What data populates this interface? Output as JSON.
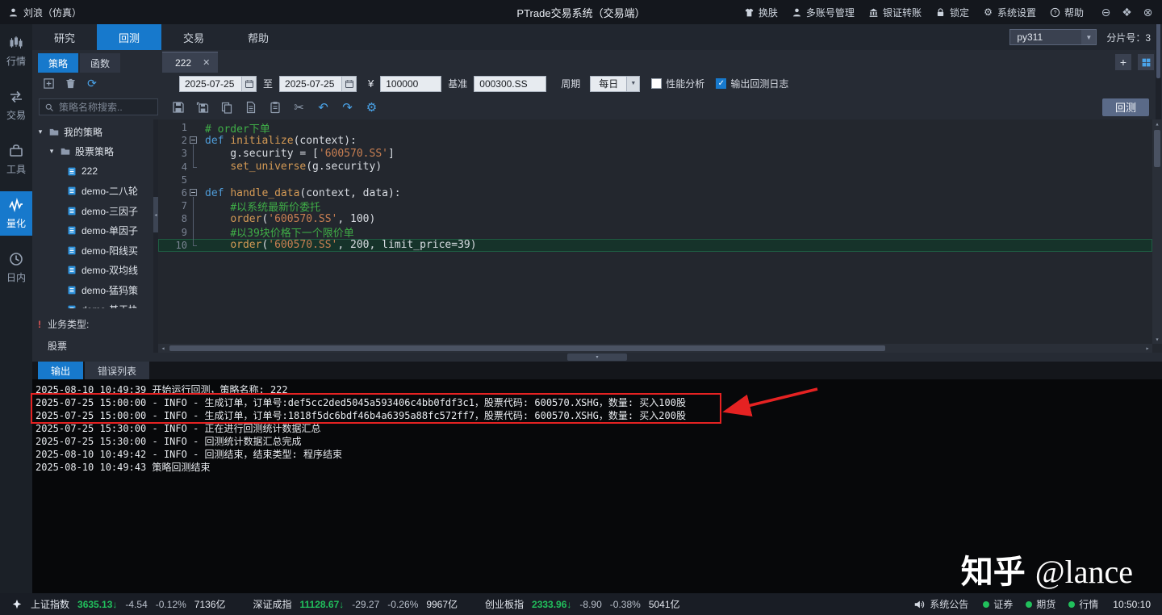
{
  "colors": {
    "accent_blue": "#1779cc",
    "down_green": "#21c05c",
    "alert_red": "#e52222"
  },
  "titlebar": {
    "user": "刘浪（仿真）",
    "title": "PTrade交易系统（交易端）",
    "actions": [
      {
        "icon": "shirt",
        "label": "换肤"
      },
      {
        "icon": "user",
        "label": "多账号管理"
      },
      {
        "icon": "bank",
        "label": "银证转账"
      },
      {
        "icon": "lock",
        "label": "锁定"
      },
      {
        "icon": "gear",
        "label": "系统设置"
      },
      {
        "icon": "help",
        "label": "帮助"
      }
    ],
    "window_buttons": [
      {
        "icon": "min",
        "name": "minimize"
      },
      {
        "icon": "max",
        "name": "maximize"
      },
      {
        "icon": "close",
        "name": "close"
      }
    ]
  },
  "navbar": {
    "tabs": [
      {
        "label": "研究",
        "active": false
      },
      {
        "label": "回测",
        "active": true
      },
      {
        "label": "交易",
        "active": false
      },
      {
        "label": "帮助",
        "active": false
      }
    ],
    "python_env": "py311",
    "shard": "分片号：3"
  },
  "rail": [
    {
      "icon": "market",
      "label": "行情",
      "active": false
    },
    {
      "icon": "trade",
      "label": "交易",
      "active": false
    },
    {
      "icon": "tools",
      "label": "工具",
      "active": false
    },
    {
      "icon": "quant",
      "label": "量化",
      "active": true
    },
    {
      "icon": "intraday",
      "label": "日内",
      "active": false
    }
  ],
  "workspace_tabs": {
    "panels": [
      {
        "label": "策略",
        "active": true
      },
      {
        "label": "函数",
        "active": false
      }
    ],
    "file_tab": "222"
  },
  "backtest_bar": {
    "strategy_toolbar": [
      "plusbox",
      "trash",
      "refresh"
    ],
    "date_from": "2025-07-25",
    "to_label": "至",
    "date_to": "2025-07-25",
    "currency": "¥",
    "capital": "100000",
    "benchmark_label": "基准",
    "benchmark": "000300.SS",
    "period_label": "周期",
    "period": "每日",
    "checkboxes": [
      {
        "label": "性能分析",
        "checked": false
      },
      {
        "label": "输出回测日志",
        "checked": true
      }
    ],
    "run_label": "回测"
  },
  "edit_toolbar": [
    {
      "icon": "floppy",
      "blue": false
    },
    {
      "icon": "floppyall",
      "blue": false
    },
    {
      "icon": "copy",
      "blue": false
    },
    {
      "icon": "doc",
      "blue": false
    },
    {
      "icon": "paste",
      "blue": false
    },
    {
      "icon": "scissors",
      "blue": false
    },
    {
      "icon": "undo",
      "blue": true
    },
    {
      "icon": "redo",
      "blue": true
    },
    {
      "icon": "gear",
      "blue": true
    }
  ],
  "search_placeholder": "策略名称搜索..",
  "tree": {
    "root": "我的策略",
    "group": "股票策略",
    "files": [
      "222",
      "demo-二八轮",
      "demo-三因子",
      "demo-单因子",
      "demo-阳线买",
      "demo-双均线",
      "demo-猛犸策",
      "demo-基于协"
    ]
  },
  "biz": {
    "label": "业务类型:",
    "value": "股票"
  },
  "editor": {
    "lines": [
      {
        "no": "1",
        "fold": "",
        "cur": false,
        "tokens": [
          {
            "c": "com",
            "t": "# order下单"
          }
        ]
      },
      {
        "no": "2",
        "fold": "open",
        "cur": false,
        "tokens": [
          {
            "c": "kw",
            "t": "def "
          },
          {
            "c": "fn",
            "t": "initialize"
          },
          {
            "c": "pl",
            "t": "(context):"
          }
        ]
      },
      {
        "no": "3",
        "fold": "mid",
        "cur": false,
        "tokens": [
          {
            "c": "pl",
            "t": "    g.security = ["
          },
          {
            "c": "str",
            "t": "'600570.SS'"
          },
          {
            "c": "pl",
            "t": "]"
          }
        ]
      },
      {
        "no": "4",
        "fold": "end",
        "cur": false,
        "tokens": [
          {
            "c": "pl",
            "t": "    "
          },
          {
            "c": "fn",
            "t": "set_universe"
          },
          {
            "c": "pl",
            "t": "(g.security)"
          }
        ]
      },
      {
        "no": "5",
        "fold": "",
        "cur": false,
        "tokens": []
      },
      {
        "no": "6",
        "fold": "open",
        "cur": false,
        "tokens": [
          {
            "c": "kw",
            "t": "def "
          },
          {
            "c": "fn",
            "t": "handle_data"
          },
          {
            "c": "pl",
            "t": "(context, data):"
          }
        ]
      },
      {
        "no": "7",
        "fold": "mid",
        "cur": false,
        "tokens": [
          {
            "c": "pl",
            "t": "    "
          },
          {
            "c": "com",
            "t": "#以系统最新价委托"
          }
        ]
      },
      {
        "no": "8",
        "fold": "mid",
        "cur": false,
        "tokens": [
          {
            "c": "pl",
            "t": "    "
          },
          {
            "c": "fn",
            "t": "order"
          },
          {
            "c": "pl",
            "t": "("
          },
          {
            "c": "str",
            "t": "'600570.SS'"
          },
          {
            "c": "pl",
            "t": ", 100)"
          }
        ]
      },
      {
        "no": "9",
        "fold": "mid",
        "cur": false,
        "tokens": [
          {
            "c": "pl",
            "t": "    "
          },
          {
            "c": "com",
            "t": "#以39块价格下一个限价单"
          }
        ]
      },
      {
        "no": "10",
        "fold": "end",
        "cur": true,
        "tokens": [
          {
            "c": "pl",
            "t": "    "
          },
          {
            "c": "fn",
            "t": "order"
          },
          {
            "c": "pl",
            "t": "("
          },
          {
            "c": "str",
            "t": "'600570.SS'"
          },
          {
            "c": "pl",
            "t": ", 200, limit_price=39)"
          }
        ]
      }
    ]
  },
  "output": {
    "tabs": [
      {
        "label": "输出",
        "active": true
      },
      {
        "label": "错误列表",
        "active": false
      }
    ],
    "logs": [
      "2025-08-10 10:49:39 开始运行回测，策略名称: 222",
      "2025-07-25 15:00:00 - INFO - 生成订单，订单号:def5cc2ded5045a593406c4bb0fdf3c1，股票代码: 600570.XSHG，数量: 买入100股",
      "2025-07-25 15:00:00 - INFO - 生成订单，订单号:1818f5dc6bdf46b4a6395a88fc572ff7，股票代码: 600570.XSHG，数量: 买入200股",
      "2025-07-25 15:30:00 - INFO - 正在进行回测统计数据汇总",
      "2025-07-25 15:30:00 - INFO - 回测统计数据汇总完成",
      "2025-08-10 10:49:42 - INFO - 回测结束，结束类型: 程序结束",
      "2025-08-10 10:49:43 策略回测结束"
    ]
  },
  "statusbar": {
    "indices": [
      {
        "name": "上证指数",
        "value": "3635.13",
        "arrow": "↓",
        "change": "-4.54",
        "pct": "-0.12%",
        "amount": "7136亿"
      },
      {
        "name": "深证成指",
        "value": "11128.67",
        "arrow": "↓",
        "change": "-29.27",
        "pct": "-0.26%",
        "amount": "9967亿"
      },
      {
        "name": "创业板指",
        "value": "2333.96",
        "arrow": "↓",
        "change": "-8.90",
        "pct": "-0.38%",
        "amount": "5041亿"
      }
    ],
    "announcement": "系统公告",
    "services": [
      "证券",
      "期货",
      "行情"
    ],
    "time": "10:50:10"
  },
  "watermark": {
    "brand": "知乎",
    "handle": "@lance"
  }
}
